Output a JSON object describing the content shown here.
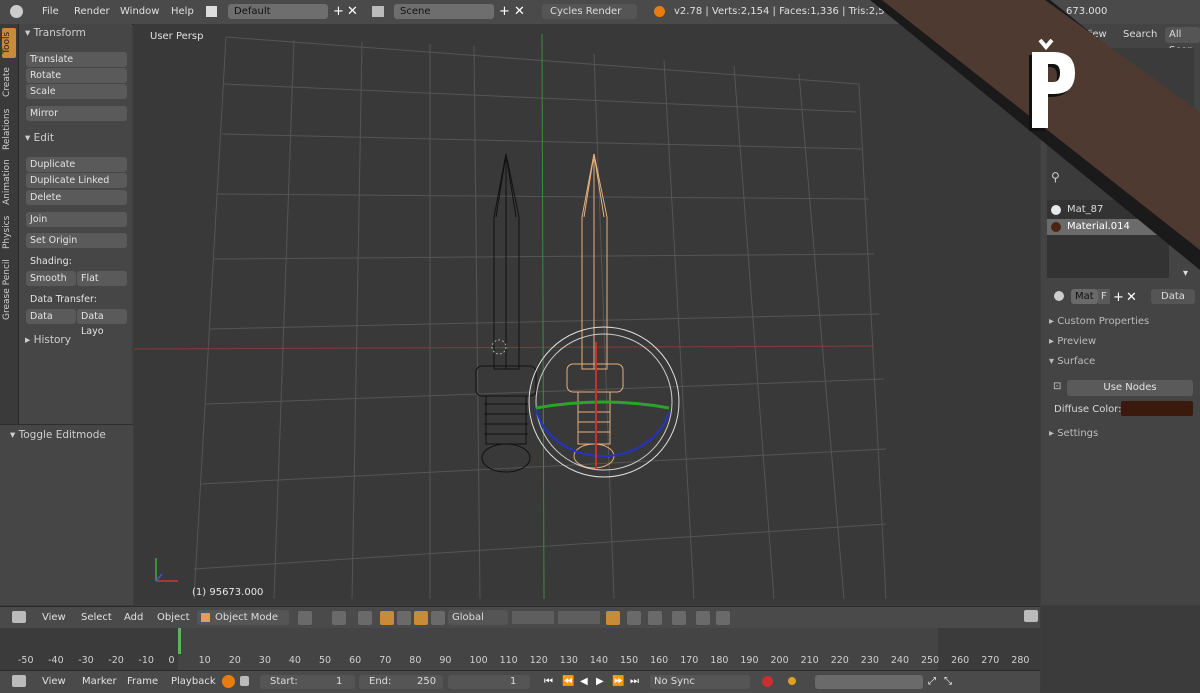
{
  "topbar": {
    "menus": [
      "File",
      "Render",
      "Window",
      "Help"
    ],
    "layout": "Default",
    "scene": "Scene",
    "engine": "Cycles Render",
    "stats": "v2.78 | Verts:2,154 | Faces:1,336 | Tris:2,5",
    "stats_right": "673.000"
  },
  "vtabs": [
    "Tools",
    "Create",
    "Relations",
    "Animation",
    "Physics",
    "Grease Pencil"
  ],
  "tools": {
    "transform_header": "Transform",
    "translate": "Translate",
    "rotate": "Rotate",
    "scale": "Scale",
    "mirror": "Mirror",
    "edit_header": "Edit",
    "duplicate": "Duplicate",
    "duplicate_linked": "Duplicate Linked",
    "delete": "Delete",
    "join": "Join",
    "set_origin": "Set Origin",
    "shading_label": "Shading:",
    "smooth": "Smooth",
    "flat": "Flat",
    "data_transfer_label": "Data Transfer:",
    "data": "Data",
    "data_layo": "Data Layo",
    "history_header": "History",
    "toggle_editmode": "Toggle Editmode"
  },
  "viewport": {
    "label": "User Persp",
    "frame_info": "(1) 95673.000"
  },
  "props": {
    "view_tab": "View",
    "search_tab": "Search",
    "all_scenes": "All Scen",
    "materials": [
      {
        "name": "Mat_87",
        "color": "#e8e8e8"
      },
      {
        "name": "Material.014",
        "color": "#4a2410"
      }
    ],
    "mat_field": "Mat",
    "f_label": "F",
    "data_select": "Data",
    "custom_properties": "Custom Properties",
    "preview": "Preview",
    "surface": "Surface",
    "use_nodes": "Use Nodes",
    "diffuse_label": "Diffuse Color:",
    "diffuse_color": "#3a1a0c",
    "settings": "Settings"
  },
  "vpheader": {
    "view": "View",
    "select": "Select",
    "add": "Add",
    "object": "Object",
    "mode": "Object Mode",
    "orientation": "Global"
  },
  "timeline": {
    "ticks": [
      "-50",
      "-40",
      "-30",
      "-20",
      "-10",
      "0",
      "10",
      "20",
      "30",
      "40",
      "50",
      "60",
      "70",
      "80",
      "90",
      "100",
      "110",
      "120",
      "130",
      "140",
      "150",
      "160",
      "170",
      "180",
      "190",
      "200",
      "210",
      "220",
      "230",
      "240",
      "250",
      "260",
      "270",
      "280"
    ],
    "view": "View",
    "marker": "Marker",
    "frame": "Frame",
    "playback": "Playback",
    "start_label": "Start:",
    "start_value": "1",
    "end_label": "End:",
    "end_value": "250",
    "current": "1",
    "sync": "No Sync"
  },
  "watermark": {
    "letter": "P",
    "band_color": "#4e3a30"
  }
}
